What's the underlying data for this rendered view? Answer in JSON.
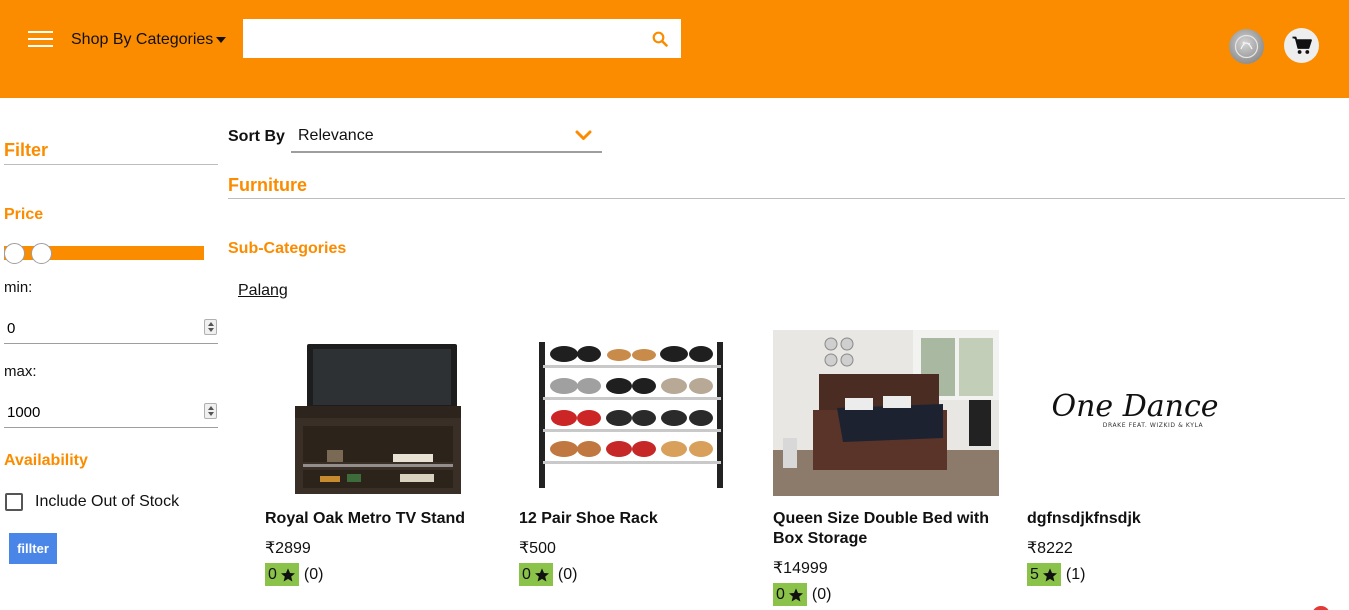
{
  "header": {
    "shop_by_label": "Shop By Categories",
    "search": {
      "value": "",
      "placeholder": ""
    },
    "colors": {
      "bar": "#fb8c00"
    },
    "icons": [
      "menu-icon",
      "caret-down-icon",
      "search-icon",
      "avatar",
      "cart-icon"
    ]
  },
  "sidebar": {
    "filter_title": "Filter",
    "price_title": "Price",
    "price_range": {
      "min_fraction": 0.0,
      "max_fraction": 0.15
    },
    "min_label": "min:",
    "min_value": "0",
    "max_label": "max:",
    "max_value": "1000",
    "availability_title": "Availability",
    "include_out_of_stock_label": "Include Out of Stock",
    "include_out_of_stock_checked": false,
    "filter_button_label": "fillter"
  },
  "main": {
    "sort_label": "Sort By",
    "sort_value": "Relevance",
    "category_title": "Furniture",
    "subcategories_title": "Sub-Categories",
    "subcategories": [
      "Palang"
    ],
    "products": [
      {
        "name": "Royal Oak Metro TV Stand",
        "price": "₹2899",
        "rating": "0",
        "reviews": "(0)",
        "image": "tv-stand-image"
      },
      {
        "name": "12 Pair Shoe Rack",
        "price": "₹500",
        "rating": "0",
        "reviews": "(0)",
        "image": "shoe-rack-image"
      },
      {
        "name": "Queen Size Double Bed with Box Storage",
        "price": "₹14999",
        "rating": "0",
        "reviews": "(0)",
        "image": "bed-image"
      },
      {
        "name": "dgfnsdjkfnsdjk",
        "price": "₹8222",
        "rating": "5",
        "reviews": "(1)",
        "image": "one-dance-image"
      }
    ],
    "image_text": {
      "one_dance_title": "One Dance",
      "one_dance_subtitle": "DRAKE FEAT. WIZKID & KYLA"
    },
    "colors": {
      "accent": "#fb8c00",
      "rating_badge": "#8bc34a",
      "button": "#4a86e8"
    }
  }
}
